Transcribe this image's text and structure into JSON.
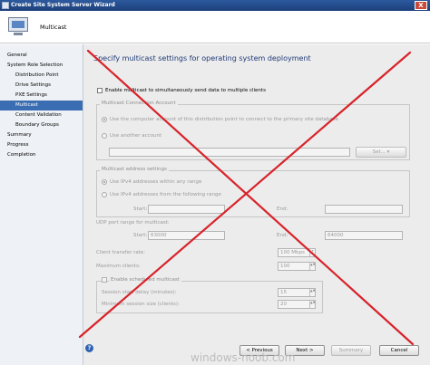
{
  "window": {
    "title": "Create Site System Server Wizard",
    "close_glyph": "X"
  },
  "header": {
    "page_name": "Multicast"
  },
  "sidebar": {
    "items": [
      {
        "label": "General",
        "level": 0,
        "active": false
      },
      {
        "label": "System Role Selection",
        "level": 0,
        "active": false
      },
      {
        "label": "Distribution Point",
        "level": 1,
        "active": false
      },
      {
        "label": "Drive Settings",
        "level": 1,
        "active": false
      },
      {
        "label": "PXE Settings",
        "level": 1,
        "active": false
      },
      {
        "label": "Multicast",
        "level": 1,
        "active": true
      },
      {
        "label": "Content Validation",
        "level": 1,
        "active": false
      },
      {
        "label": "Boundary Groups",
        "level": 1,
        "active": false
      },
      {
        "label": "Summary",
        "level": 0,
        "active": false
      },
      {
        "label": "Progress",
        "level": 0,
        "active": false
      },
      {
        "label": "Completion",
        "level": 0,
        "active": false
      }
    ]
  },
  "main": {
    "heading": "Specify multicast settings for operating system deployment",
    "enable_multicast": "Enable multicast to simultaneously send data to multiple clients",
    "connection_account": {
      "legend": "Multicast Connection Account",
      "option_computer": "Use the computer account of this distribution point to connect to the primary site database",
      "option_another": "Use another account",
      "set_button": "Set..."
    },
    "address_settings": {
      "legend": "Multicast address settings",
      "option_any": "Use IPv4 addresses within any range",
      "option_range": "Use IPv4 addresses from the following range",
      "start_label": "Start:",
      "end_label": "End:"
    },
    "udp": {
      "label": "UDP port range for multicast:",
      "start_label": "Start:",
      "start_value": "63000",
      "end_label": "End:",
      "end_value": "64000"
    },
    "transfer_rate": {
      "label": "Client transfer rate:",
      "value": "100 Mbps"
    },
    "max_clients": {
      "label": "Maximum clients:",
      "value": "100"
    },
    "scheduled": {
      "label": "Enable scheduled multicast",
      "delay_label": "Session start delay (minutes):",
      "delay_value": "15",
      "min_size_label": "Minimum session size (clients):",
      "min_size_value": "20"
    }
  },
  "buttons": {
    "previous": "< Previous",
    "next": "Next >",
    "summary": "Summary",
    "cancel": "Cancel"
  },
  "help_glyph": "?",
  "watermark": "windows-noob.com",
  "overlay_color": "#d8232a"
}
